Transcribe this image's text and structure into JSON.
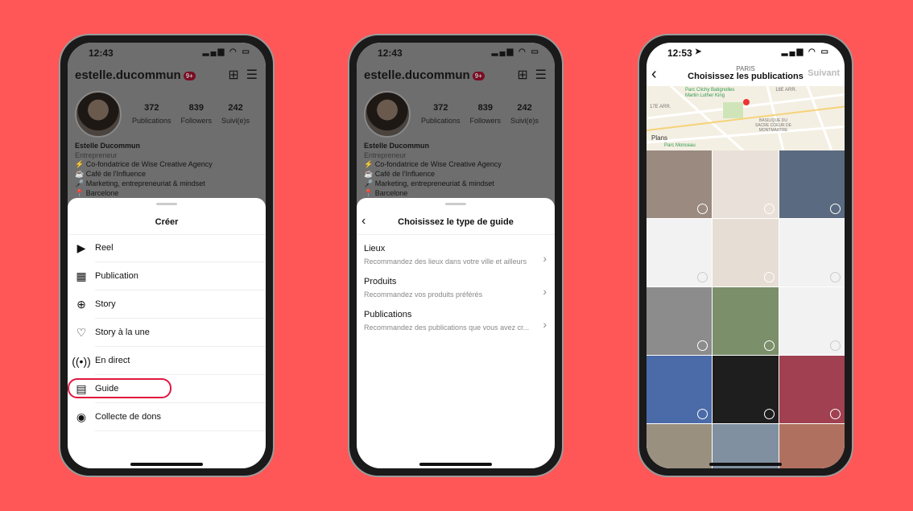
{
  "colors": {
    "background": "#ff5757",
    "accent": "#e0163f"
  },
  "profile": {
    "time": "12:43",
    "username": "estelle.ducommun",
    "notif_badge": "9+",
    "stats": [
      {
        "value": "372",
        "label": "Publications"
      },
      {
        "value": "839",
        "label": "Followers"
      },
      {
        "value": "242",
        "label": "Suivi(e)s"
      }
    ],
    "name": "Estelle Ducommun",
    "category": "Entrepreneur",
    "bio": [
      "⚡ Co-fondatrice de Wise Creative Agency",
      "☕ Café de l'Influence",
      "🎤 Marketing, entrepreneuriat & mindset",
      "📍 Barcelone"
    ]
  },
  "create_sheet": {
    "title": "Créer",
    "items": [
      {
        "label": "Reel",
        "icon": "reel-icon"
      },
      {
        "label": "Publication",
        "icon": "grid-icon"
      },
      {
        "label": "Story",
        "icon": "story-add-icon"
      },
      {
        "label": "Story à la une",
        "icon": "highlight-icon"
      },
      {
        "label": "En direct",
        "icon": "live-icon"
      },
      {
        "label": "Guide",
        "icon": "guide-icon"
      },
      {
        "label": "Collecte de dons",
        "icon": "fundraiser-icon"
      }
    ],
    "highlighted": "Guide"
  },
  "guide_sheet": {
    "title": "Choisissez le type de guide",
    "items": [
      {
        "title": "Lieux",
        "desc": "Recommandez des lieux dans votre ville et ailleurs"
      },
      {
        "title": "Produits",
        "desc": "Recommandez vos produits préférés"
      },
      {
        "title": "Publications",
        "desc": "Recommandez des publications que vous avez cr..."
      }
    ]
  },
  "choose_posts": {
    "time": "12:53",
    "location": "PARIS",
    "title": "Choisissez les publications",
    "next": "Suivant",
    "map_labels": [
      "Parc Clichy Batignolles Martin Luther King",
      "18E ARR.",
      "17E ARR.",
      "BASILIQUE DU SACRE COEUR DE MONTMARTRE",
      "Plans",
      "Parc Monceau"
    ]
  }
}
